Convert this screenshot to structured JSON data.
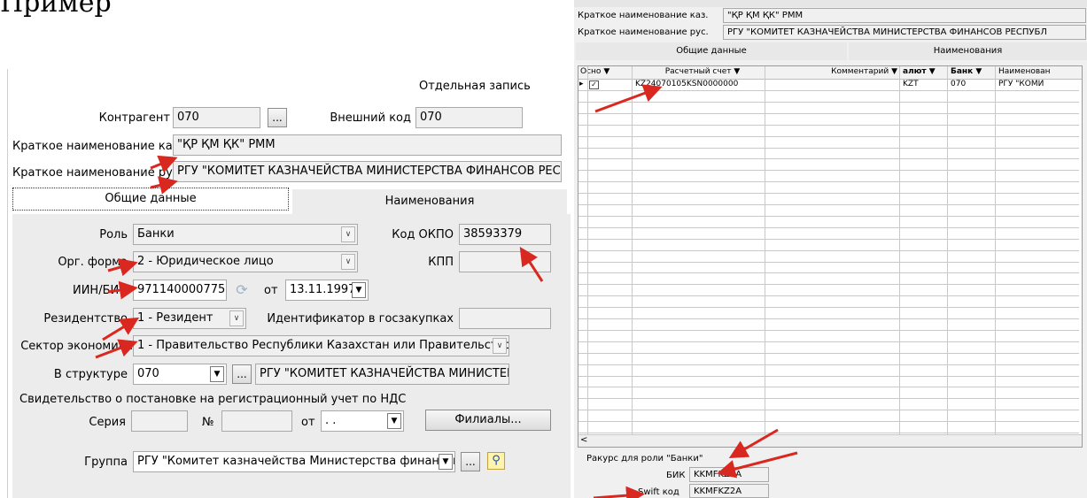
{
  "doc_text": "Пример",
  "left": {
    "header": "Отдельная запись",
    "kontragent_label": "Контрагент",
    "kontragent_value": "070",
    "ext_code_label": "Внешний код",
    "ext_code_value": "070",
    "short_kaz_label": "Краткое наименование каз.",
    "short_kaz_value": "\"ҚР ҚМ ҚК\" РММ",
    "short_rus_label": "Краткое наименование рус.",
    "short_rus_value": "РГУ \"КОМИТЕТ КАЗНАЧЕЙСТВА МИНИСТЕРСТВА ФИНАНСОВ РЕСПУБЛ",
    "tabs": [
      "Общие данные",
      "Наименования"
    ],
    "role_label": "Роль",
    "role_value": "Банки",
    "okpo_label": "Код ОКПО",
    "okpo_value": "38593379",
    "org_form_label": "Орг. форма",
    "org_form_value": "2 - Юридическое лицо",
    "kpp_label": "КПП",
    "kpp_value": "",
    "iin_label": "ИИН/БИН",
    "iin_value": "971140000775",
    "from_label": "от",
    "date_value": "13.11.1997",
    "resident_label": "Резидентство",
    "resident_value": "1 - Резидент",
    "goszak_label": "Идентификатор в госзакупках",
    "sector_label": "Сектор экономики",
    "sector_value": "1 - Правительство Республики Казахстан или Правительство и",
    "structure_label": "В структуре",
    "structure_value": "070",
    "structure_name": "РГУ \"КОМИТЕТ КАЗНАЧЕЙСТВА МИНИСТЕРС",
    "nds_label": "Свидетельство о постановке на регистрационный учет по НДС",
    "series_label": "Серия",
    "num_label": "№",
    "from2_label": "от",
    "date2_value": ". .",
    "branches_button": "Филиалы...",
    "group_label": "Группа",
    "group_value": "РГУ \"Комитет казначейства Министерства финансов I",
    "ellipsis": "..."
  },
  "right": {
    "short_kaz_label": "Краткое наименование каз.",
    "short_kaz_value": "\"ҚР ҚМ ҚК\" РММ",
    "short_rus_label": "Краткое наименование рус.",
    "short_rus_value": "РГУ \"КОМИТЕТ КАЗНАЧЕЙСТВА МИНИСТЕРСТВА ФИНАНСОВ РЕСПУБЛ",
    "tabs": [
      "Общие данные",
      "Наименования"
    ],
    "columns": [
      "Осно",
      "Расчетный счет",
      "Комментарий",
      "алют",
      "Банк",
      "Наименован"
    ],
    "row": {
      "account": "KZ24070105KSN0000000",
      "comment": "",
      "currency": "KZT",
      "bank": "070",
      "name": "РГУ \"КОМИ"
    },
    "scroll_left": "<",
    "perspective_label": "Ракурс для роли \"Банки\"",
    "bik_label": "БИК",
    "bik_value": "KKMFKZ2A",
    "swift_label": "Swift код",
    "swift_value": "KKMFKZ2A"
  },
  "colors": {
    "arrow": "#d8281f",
    "field_bg": "#f0f0f0",
    "border": "#a9a9a9"
  }
}
